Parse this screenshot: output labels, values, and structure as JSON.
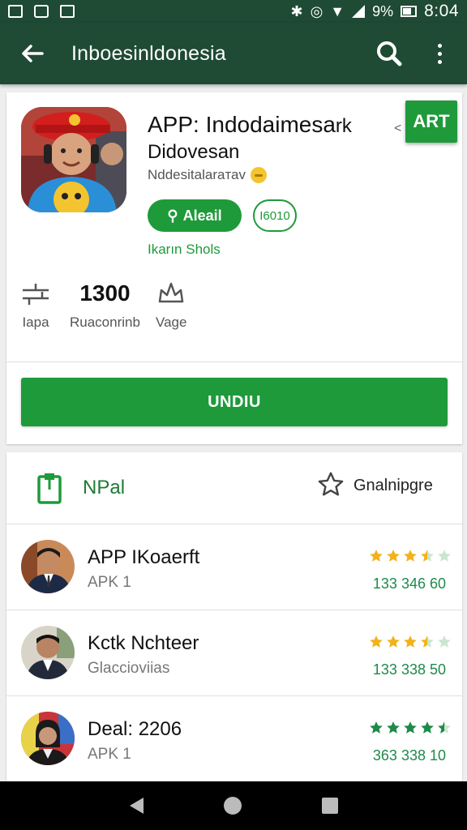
{
  "status_bar": {
    "time": "8:04",
    "battery": "9%"
  },
  "app_bar": {
    "title": "Inboesinldonesia"
  },
  "app": {
    "name_line1": "APP: Indodaimesa",
    "name_line1_tail": "rk",
    "name_line2": "Didovesan",
    "developer": "Nddesitalaraтаv",
    "tag_right": "<",
    "badge": "ART",
    "primary_chip": "Aleail",
    "secondary_chip": "I6010",
    "link": "Ikarın Shols"
  },
  "stats": [
    {
      "value": "",
      "label": "Iapa",
      "icon": "adjust-icon"
    },
    {
      "value": "1300",
      "label": "Ruaconrinb",
      "icon": ""
    },
    {
      "value": "",
      "label": "Vage",
      "icon": "crown-icon"
    }
  ],
  "install_button": "UNDIU",
  "list": {
    "header_label": "NPal",
    "header_right": "Gnalnipgre",
    "items": [
      {
        "title": "APP IKoaerft",
        "subtitle": "APK 1",
        "rating_text": "133 346 60",
        "stars": [
          1,
          1,
          1,
          0.5,
          0
        ],
        "star_color": "#f2b21c"
      },
      {
        "title": "Kctk Nchteer",
        "subtitle": "Glaccioviias",
        "rating_text": "133 338 50",
        "stars": [
          1,
          1,
          1,
          0.5,
          0
        ],
        "star_color": "#f2b21c"
      },
      {
        "title": "Deal: 2206",
        "subtitle": "APK 1",
        "rating_text": "363 338 10",
        "stars": [
          1,
          1,
          1,
          1,
          0.5
        ],
        "star_color": "#1e8a4a"
      }
    ]
  },
  "colors": {
    "bar": "#1f4a34",
    "accent": "#1e9a3a"
  }
}
